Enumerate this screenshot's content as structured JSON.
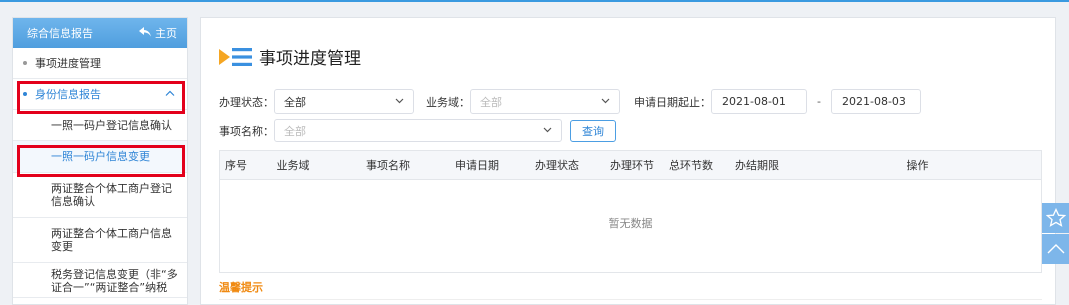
{
  "sidebar": {
    "header_title": "综合信息报告",
    "home_label": "主页",
    "items": [
      {
        "label": "事项进度管理"
      },
      {
        "label": "身份信息报告"
      }
    ],
    "sub_items": [
      {
        "label": "一照一码户登记信息确认"
      },
      {
        "label": "一照一码户信息变更"
      },
      {
        "label": "两证整合个体工商户登记信息确认"
      },
      {
        "label": "两证整合个体工商户信息变更"
      },
      {
        "label": "税务登记信息变更（非“多证合一”“两证整合”纳税"
      }
    ]
  },
  "main": {
    "page_title": "事项进度管理",
    "filters": {
      "status_label": "办理状态：",
      "status_value": "全部",
      "domain_label": "业务域：",
      "domain_placeholder": "全部",
      "date_label": "申请日期起止：",
      "date_start": "2021-08-01",
      "date_sep": "-",
      "date_end": "2021-08-03",
      "item_label": "事项名称：",
      "item_placeholder": "全部",
      "query_button": "查询"
    },
    "table": {
      "columns": [
        "序号",
        "业务域",
        "事项名称",
        "申请日期",
        "办理状态",
        "办理环节",
        "总环节数",
        "办结期限",
        "操作"
      ],
      "empty_text": "暂无数据"
    },
    "tips_title": "温馨提示"
  },
  "colors": {
    "accent": "#2f85d6",
    "header_blue": "#5ba6e3",
    "highlight_red": "#e3001b",
    "tips_orange": "#f08a12",
    "float_button": "#7db6ea"
  },
  "icons": {
    "home": "home-arrow-icon",
    "title": "list-title-icon",
    "favorite": "star-icon",
    "back_to_top": "chevron-up-icon"
  }
}
